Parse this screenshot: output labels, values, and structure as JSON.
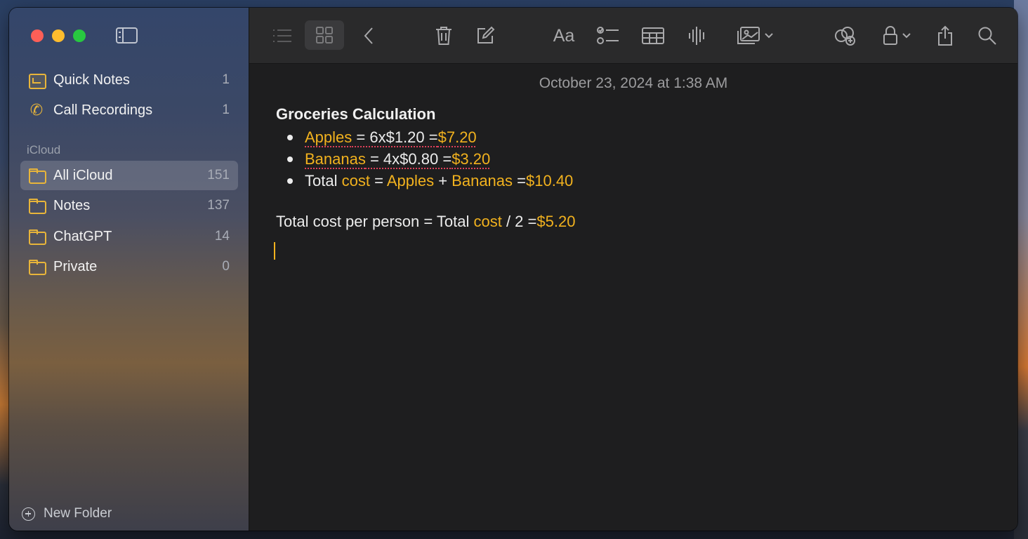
{
  "sidebar": {
    "items_top": [
      {
        "label": "Quick Notes",
        "count": "1",
        "icon": "quick-notes-icon"
      },
      {
        "label": "Call Recordings",
        "count": "1",
        "icon": "phone-icon"
      }
    ],
    "section_label": "iCloud",
    "folders": [
      {
        "label": "All iCloud",
        "count": "151",
        "selected": true
      },
      {
        "label": "Notes",
        "count": "137"
      },
      {
        "label": "ChatGPT",
        "count": "14"
      },
      {
        "label": "Private",
        "count": "0"
      }
    ],
    "new_folder_label": "New Folder"
  },
  "note": {
    "date": "October 23, 2024 at 1:38 AM",
    "title": "Groceries Calculation",
    "lines": [
      {
        "var": "Apples",
        "expr": " = 6x$1.20  =",
        "result": "$7.20"
      },
      {
        "var": "Bananas",
        "expr": " = 4x$0.80  =",
        "result": "$3.20"
      },
      {
        "prefix": "Total ",
        "var1": "cost",
        "mid1": " = ",
        "var2": "Apples",
        "mid2": " + ",
        "var3": "Bananas",
        "mid3": "  =",
        "result": "$10.40"
      }
    ],
    "person": {
      "prefix": "Total cost per person = Total ",
      "var": "cost",
      "mid": " / 2  =",
      "result": "$5.20"
    }
  },
  "colors": {
    "accent": "#f2b21e",
    "folder": "#e8b53a"
  }
}
